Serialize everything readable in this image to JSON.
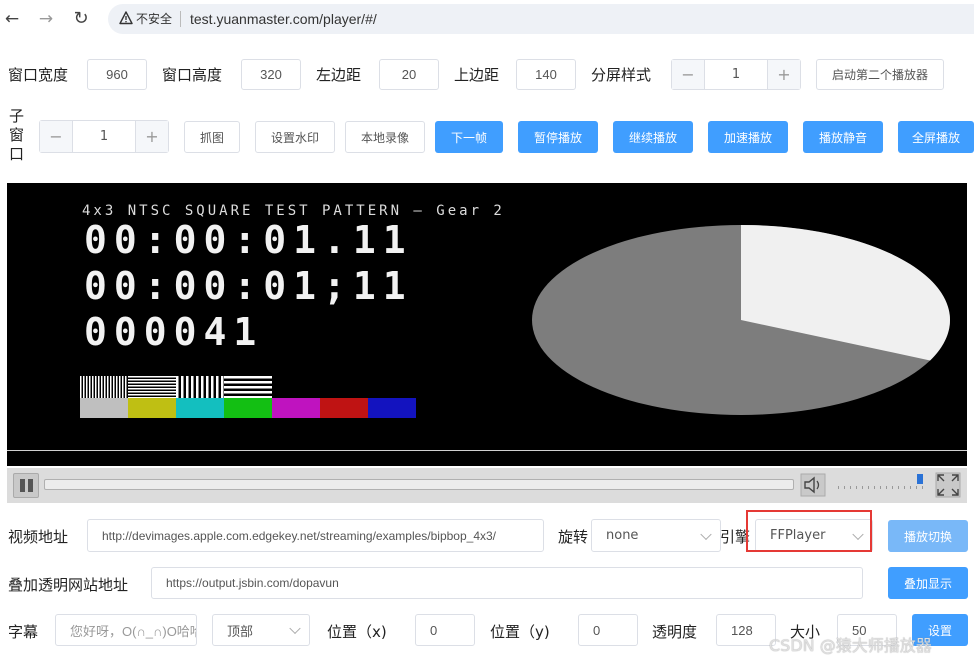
{
  "browser": {
    "back_icon": "arrow-left-icon",
    "forward_icon": "arrow-right-icon",
    "reload_icon": "reload-icon",
    "insecure_label": "不安全",
    "url": "test.yuanmaster.com/player/#/"
  },
  "row1": {
    "width_label": "窗口宽度",
    "width_value": "960",
    "height_label": "窗口高度",
    "height_value": "320",
    "left_label": "左边距",
    "left_value": "20",
    "top_label": "上边距",
    "top_value": "140",
    "split_label": "分屏样式",
    "split_value": "1",
    "start_second_button": "启动第二个播放器"
  },
  "row2": {
    "subwindow_label": [
      "子",
      "窗",
      "口"
    ],
    "subwindow_value": "1",
    "snapshot_button": "抓图",
    "watermark_button": "设置水印",
    "record_button": "本地录像",
    "next_frame_button": "下一帧",
    "pause_button": "暂停播放",
    "resume_button": "继续播放",
    "speed_button": "加速播放",
    "mute_button": "播放静音",
    "fullscreen_button": "全屏播放"
  },
  "video": {
    "title": "4x3 NTSC SQUARE TEST PATTERN — Gear 2",
    "timecode1": "00:00:01.11",
    "timecode2": "00:00:01;11",
    "frame": "000041",
    "color_bars": [
      "#bfbfbf",
      "#bfbf13",
      "#13bfbf",
      "#13bf13",
      "#bf13bf",
      "#bf1313",
      "#1313bf"
    ],
    "pie_white_fraction": 0.32,
    "volume_level": 1.0
  },
  "row3": {
    "url_label": "视频地址",
    "url_value": "http://devimages.apple.com.edgekey.net/streaming/examples/bipbop_4x3/",
    "rotate_label": "旋转",
    "rotate_value": "none",
    "engine_label": "引擎",
    "engine_value": "FFPlayer",
    "switch_button": "播放切换"
  },
  "row4": {
    "overlay_label": "叠加透明网站地址",
    "overlay_value": "https://output.jsbin.com/dopavun",
    "overlay_button": "叠加显示"
  },
  "row5": {
    "subtitle_label": "字幕",
    "subtitle_placeholder": "您好呀，O(∩_∩)O哈哈~",
    "position_select": "顶部",
    "posx_label": "位置（x)",
    "posx_value": "0",
    "posy_label": "位置（y)",
    "posy_value": "0",
    "opacity_label": "透明度",
    "opacity_value": "128",
    "size_label": "大小",
    "size_value": "50",
    "set_button": "设置"
  },
  "watermark": "CSDN @猿大师播放器",
  "colors": {
    "accent": "#409eff",
    "highlight_box": "#e53935"
  }
}
